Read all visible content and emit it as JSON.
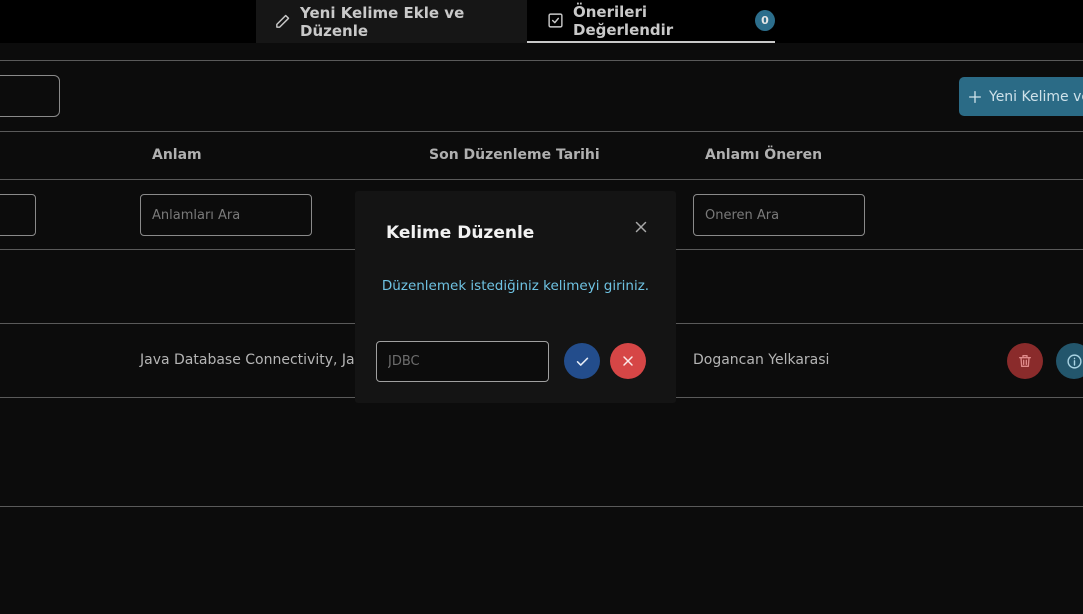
{
  "tabs": [
    {
      "label": "Yeni Kelime Ekle ve Düzenle",
      "icon": "pencil-icon"
    },
    {
      "label": "Önerileri Değerlendir",
      "icon": "checkbox-icon",
      "badge": "0"
    }
  ],
  "toolbar": {
    "add_button_label": "Yeni Kelime ve"
  },
  "table": {
    "headers": [
      "Anlam",
      "Son Düzenleme Tarihi",
      "Anlamı Öneren"
    ],
    "filters": {
      "meaning_placeholder": "Anlamları Ara",
      "suggester_placeholder": "Öneren Ara"
    },
    "rows": [
      {
        "meaning": "Java Database Connectivity, Java",
        "suggester": "Dogancan Yelkarasi"
      }
    ]
  },
  "modal": {
    "title": "Kelime Düzenle",
    "message": "Düzenlemek istediğiniz kelimeyi giriniz.",
    "input_value": "",
    "input_placeholder": "JDBC"
  },
  "colors": {
    "background": "#0c0c0c",
    "accent": "#2b6b86",
    "confirm": "#234d8c",
    "danger": "#d64646",
    "message": "#6fc3e3"
  }
}
